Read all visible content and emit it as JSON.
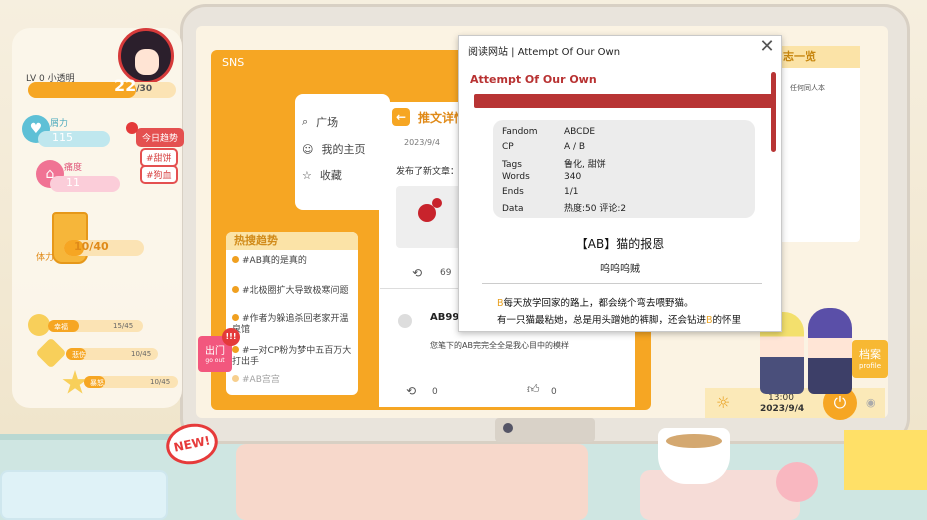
{
  "player": {
    "level": "LV 0",
    "name": "小透明",
    "xp_value": "22",
    "xp_max": "/30",
    "xp_progress": 0.733
  },
  "stats": {
    "power": {
      "label": "屑力",
      "value": "115"
    },
    "pain": {
      "label": "痛度",
      "value": "11"
    },
    "stamina": {
      "label": "体力",
      "value": "10/40",
      "progress": 0.25
    }
  },
  "trending_tags": {
    "label": "今日趋势",
    "tags": [
      "#甜饼",
      "#狗血"
    ]
  },
  "moods": [
    {
      "label": "幸福",
      "value": "15/45",
      "progress": 0.33
    },
    {
      "label": "悲伤",
      "value": "10/45",
      "progress": 0.22
    },
    {
      "label": "暴怒",
      "value": "10/45",
      "progress": 0.22
    }
  ],
  "go_out": {
    "label": "出门",
    "sublabel": "go out",
    "alert": "!!!"
  },
  "new_badge": "NEW!",
  "sns": {
    "window_title": "SNS",
    "nav": [
      {
        "label": "广场",
        "icon": "search-icon"
      },
      {
        "label": "我的主页",
        "icon": "user-icon"
      },
      {
        "label": "收藏",
        "icon": "star-icon"
      }
    ],
    "trend_title": "热搜趋势",
    "trend_items": [
      "#AB真的是真的",
      "#北极圈扩大导致极寒问题",
      "#作者为躲追杀回老家开温泉馆",
      "#一对CP粉为梦中五百万大打出手",
      "#AB宫宫"
    ],
    "detail_title": "推文详情",
    "post_date": "2023/9/4",
    "post_text": "发布了新文章：",
    "repost_count": "69",
    "comment_user": "AB99",
    "comment_text": "您笔下的AB完完全全是我心目中的模样",
    "comment_repost": "0",
    "comment_like": "0"
  },
  "popup": {
    "site_title": "阅读网站 | Attempt Of Our Own",
    "work_title": "Attempt Of Our Own",
    "meta": [
      {
        "key": "Fandom",
        "value": "ABCDE"
      },
      {
        "key": "CP",
        "value": "A / B"
      },
      {
        "key": "Tags",
        "value": "鲁化, 甜饼"
      },
      {
        "key": "Words",
        "value": "340"
      },
      {
        "key": "Ends",
        "value": "1/1"
      },
      {
        "key": "Data",
        "value": "热度:50  评论:2"
      }
    ],
    "story_title": "【AB】猫的报恩",
    "author": "呜呜呜贼",
    "story_lines": [
      {
        "pre": "",
        "hl": "B",
        "post": "每天放学回家的路上，都会绕个弯去喂野猫。"
      },
      {
        "pre": "有一只猫最粘她，总是用头蹭她的裤脚，还会钻进",
        "hl": "B",
        "post": "的怀里"
      }
    ]
  },
  "log_panel": {
    "title": "志一览",
    "subtitle": "任何同人本"
  },
  "taskbar": {
    "time": "13:00",
    "date": "2023/9/4"
  },
  "archive": {
    "label": "档案",
    "sublabel": "profile"
  },
  "colors": {
    "accent": "#f6a623",
    "popup_red": "#b83434",
    "highlight": "#e8a020"
  }
}
